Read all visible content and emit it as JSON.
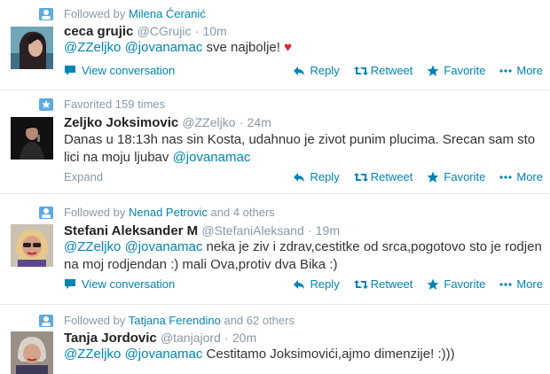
{
  "tweets": [
    {
      "context": {
        "prefix": "Followed by",
        "names": "Milena Ćeranić",
        "suffix": ""
      },
      "name": "ceca grujic",
      "handle": "@CGrujic",
      "time": "10m",
      "text": {
        "m1": "@ZZeljko",
        "m2": "@jovanamac",
        "body": "sve najbolje!",
        "heart": "♥"
      },
      "footer_link": "View conversation"
    },
    {
      "context": {
        "prefix": "Favorited 159 times",
        "names": "",
        "suffix": ""
      },
      "name": "Zeljko Joksimovic",
      "handle": "@ZZeljko",
      "time": "24m",
      "text": {
        "body": "Danas u 18:13h nas sin Kosta, udahnuo je zivot punim plucima. Srecan sam sto lici na moju ljubav",
        "m1": "@jovanamac"
      },
      "footer_link": "Expand"
    },
    {
      "context": {
        "prefix": "Followed by",
        "names": "Nenad Petrovic",
        "suffix": "and 4 others"
      },
      "name": "Stefani Aleksander M",
      "handle": "@StefaniAleksand",
      "time": "19m",
      "text": {
        "m1": "@ZZeljko",
        "m2": "@jovanamac",
        "body": "neka je ziv i zdrav,cestitke od srca,pogotovo sto je rodjen na moj rodjendan :) mali Ova,protiv dva Bika :)"
      },
      "footer_link": "View conversation"
    },
    {
      "context": {
        "prefix": "Followed by",
        "names": "Tatjana Ferendino",
        "suffix": "and 62 others"
      },
      "name": "Tanja Jordovic",
      "handle": "@tanjajord",
      "time": "20m",
      "text": {
        "m1": "@ZZeljko",
        "m2": "@jovanamac",
        "body": "Cestitamo Joksimovići,ajmo dimenzije! :)))"
      }
    }
  ],
  "actions": {
    "reply": "Reply",
    "retweet": "Retweet",
    "favorite": "Favorite",
    "more": "More"
  },
  "colors": {
    "link": "#0084b4",
    "muted": "#8899a6",
    "heart": "#e0242f"
  }
}
